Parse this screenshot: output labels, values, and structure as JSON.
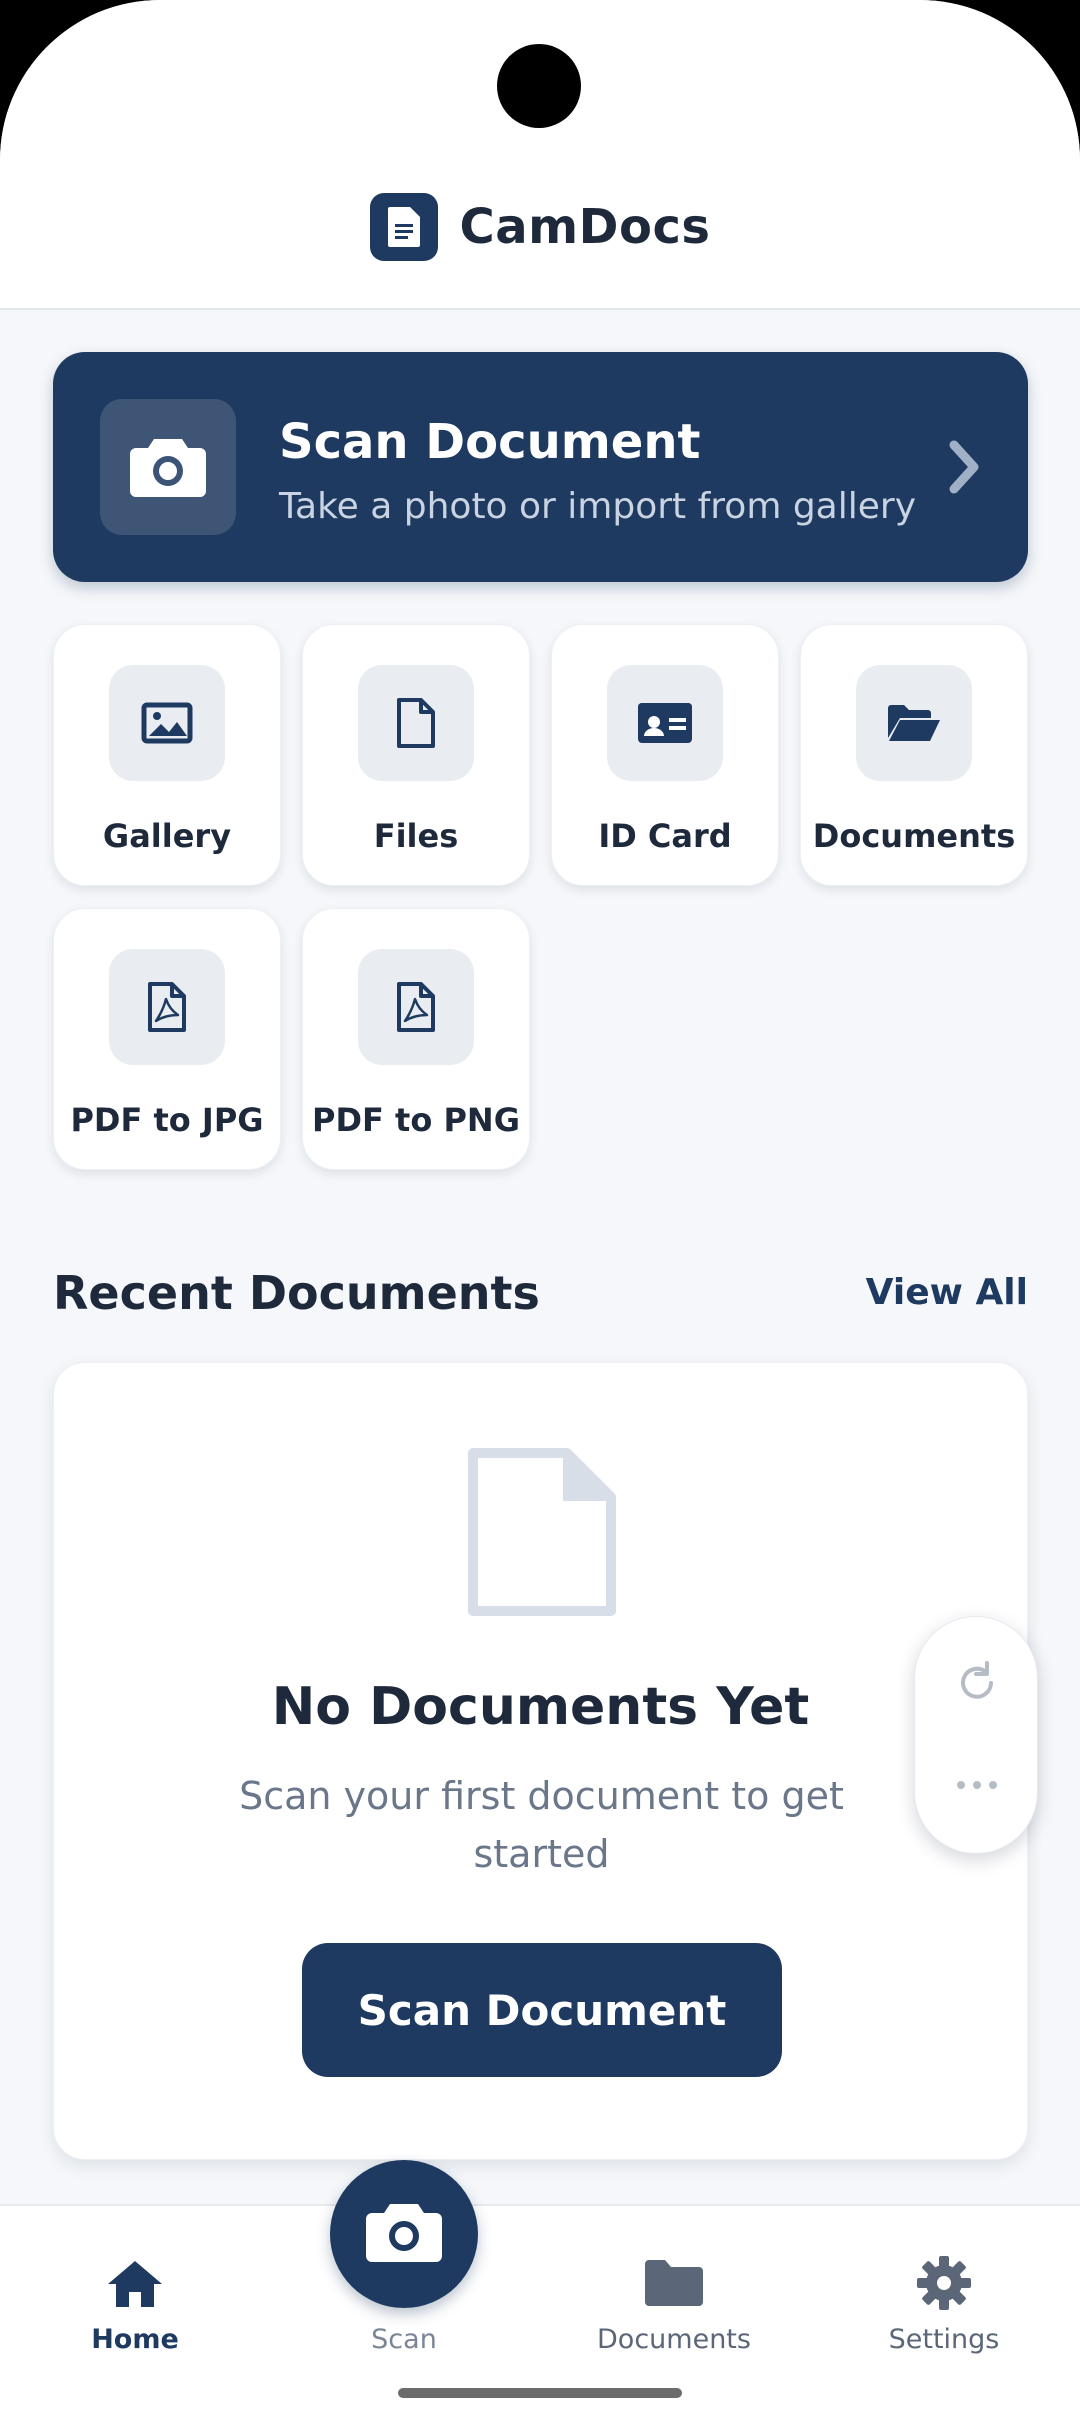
{
  "app": {
    "title": "CamDocs"
  },
  "hero": {
    "title": "Scan Document",
    "subtitle": "Take a photo or import from gallery"
  },
  "tiles": [
    {
      "label": "Gallery",
      "icon": "image-icon"
    },
    {
      "label": "Files",
      "icon": "file-icon"
    },
    {
      "label": "ID Card",
      "icon": "id-card-icon"
    },
    {
      "label": "Documents",
      "icon": "folder-open-icon"
    },
    {
      "label": "PDF to JPG",
      "icon": "pdf-icon"
    },
    {
      "label": "PDF to PNG",
      "icon": "pdf-icon"
    }
  ],
  "recent": {
    "title": "Recent Documents",
    "view_all": "View All",
    "empty_title": "No Documents Yet",
    "empty_subtitle": "Scan your first document to get started",
    "empty_button": "Scan Document"
  },
  "nav": {
    "items": [
      {
        "label": "Home",
        "icon": "home-icon",
        "active": true
      },
      {
        "label": "Scan",
        "icon": "camera-icon",
        "active": false
      },
      {
        "label": "Documents",
        "icon": "folder-icon",
        "active": false
      },
      {
        "label": "Settings",
        "icon": "gear-icon",
        "active": false
      }
    ]
  },
  "colors": {
    "primary": "#1f3a60",
    "background": "#f5f7fa",
    "card": "#ffffff"
  }
}
